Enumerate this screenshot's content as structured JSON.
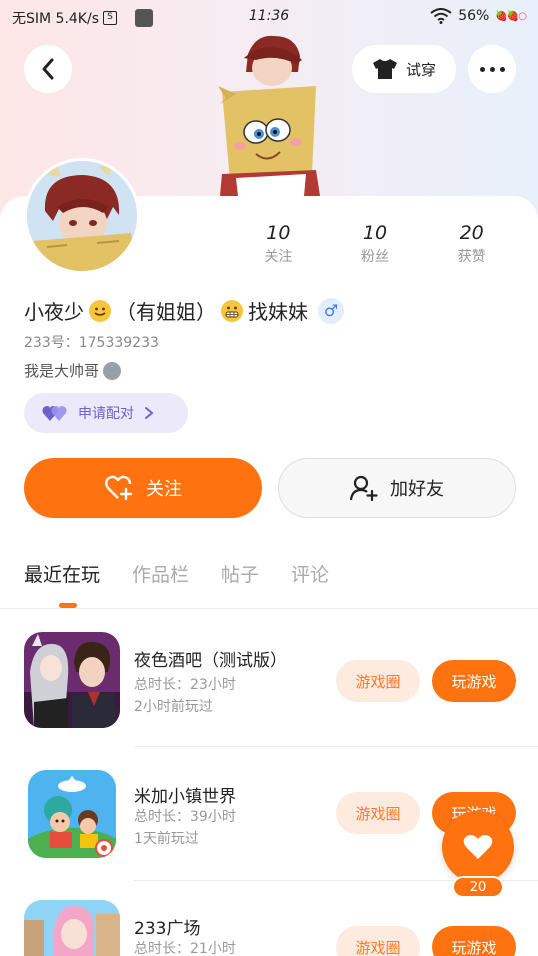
{
  "status_bar": {
    "carrier": "无SIM 5.4K/s",
    "time": "11:36",
    "battery": "56%"
  },
  "header": {
    "try_on_label": "试穿"
  },
  "profile": {
    "stats": [
      {
        "value": "10",
        "label": "关注"
      },
      {
        "value": "10",
        "label": "粉丝"
      },
      {
        "value": "20",
        "label": "获赞"
      }
    ],
    "name_part1": "小夜少",
    "name_part2": "（有姐姐）",
    "name_part3": "找妹妹",
    "gender_icon": "male-icon",
    "uid": "233号：175339233",
    "bio": "我是大帅哥",
    "pair_label": "申请配对",
    "follow_label": "关注",
    "add_friend_label": "加好友"
  },
  "tabs": [
    {
      "label": "最近在玩",
      "active": true
    },
    {
      "label": "作品栏",
      "active": false
    },
    {
      "label": "帖子",
      "active": false
    },
    {
      "label": "评论",
      "active": false
    }
  ],
  "games": [
    {
      "title": "夜色酒吧（测试版）",
      "duration": "总时长：23小时",
      "last_played": "2小时前玩过",
      "circle_label": "游戏圈",
      "play_label": "玩游戏"
    },
    {
      "title": "米加小镇世界",
      "duration": "总时长：39小时",
      "last_played": "1天前玩过",
      "circle_label": "游戏圈",
      "play_label": "玩游戏"
    },
    {
      "title": "233广场",
      "duration": "总时长：21小时",
      "last_played": "",
      "circle_label": "游戏圈",
      "play_label": "玩游戏"
    }
  ],
  "fab": {
    "count": "20"
  },
  "colors": {
    "accent": "#ff7210",
    "accent_light": "#ffeadf",
    "pair_bg": "#ece9fb",
    "pair_text": "#6e62c8"
  }
}
